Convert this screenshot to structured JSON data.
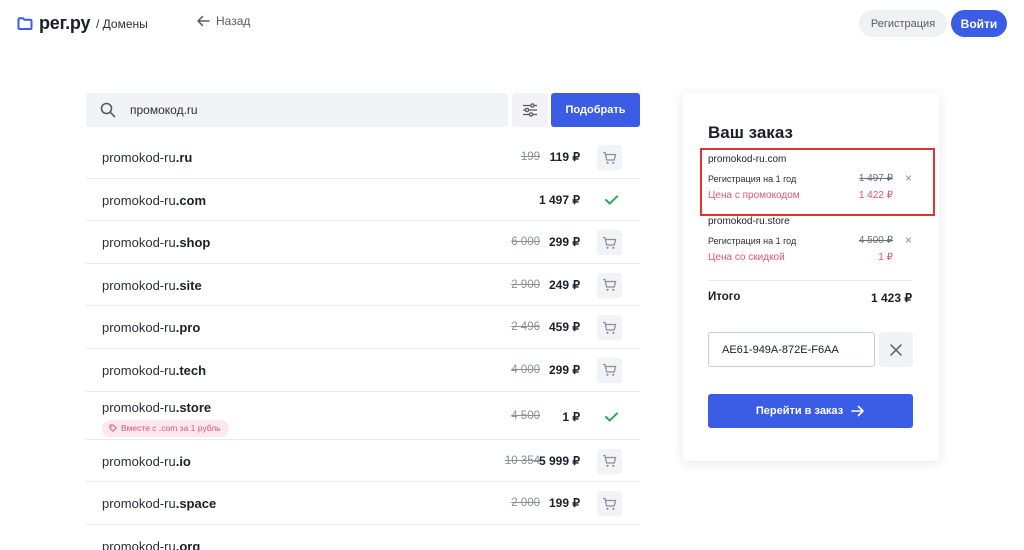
{
  "header": {
    "logo_text": "рег.ру",
    "breadcrumb": "/ Домены",
    "back_label": "Назад",
    "register_label": "Регистрация",
    "login_label": "Войти"
  },
  "search": {
    "query": "промокод.ru",
    "submit_label": "Подобрать"
  },
  "domains": [
    {
      "name": "promokod-ru",
      "tld": ".ru",
      "old_price": "199",
      "price": "119 ₽",
      "state": "cart"
    },
    {
      "name": "promokod-ru",
      "tld": ".com",
      "old_price": "",
      "price": "1 497 ₽",
      "state": "added"
    },
    {
      "name": "promokod-ru",
      "tld": ".shop",
      "old_price": "6 000",
      "price": "299 ₽",
      "state": "cart"
    },
    {
      "name": "promokod-ru",
      "tld": ".site",
      "old_price": "2 900",
      "price": "249 ₽",
      "state": "cart"
    },
    {
      "name": "promokod-ru",
      "tld": ".pro",
      "old_price": "2 496",
      "price": "459 ₽",
      "state": "cart"
    },
    {
      "name": "promokod-ru",
      "tld": ".tech",
      "old_price": "4 000",
      "price": "299 ₽",
      "state": "cart"
    },
    {
      "name": "promokod-ru",
      "tld": ".store",
      "old_price": "4 500",
      "price": "1 ₽",
      "state": "added",
      "badge": "Вместе с .com за 1 рубль"
    },
    {
      "name": "promokod-ru",
      "tld": ".io",
      "old_price": "10 354",
      "price": "5 999 ₽",
      "state": "cart"
    },
    {
      "name": "promokod-ru",
      "tld": ".space",
      "old_price": "2 000",
      "price": "199 ₽",
      "state": "cart"
    },
    {
      "name": "promokod-ru",
      "tld": ".org",
      "old_price": "",
      "price": "",
      "state": "cart"
    }
  ],
  "order": {
    "title": "Ваш заказ",
    "items": [
      {
        "domain": "promokod-ru.com",
        "reg_label": "Регистрация на 1 год",
        "old_price": "1 497 ₽",
        "discount_label": "Цена с промокодом",
        "discount_price": "1 422 ₽"
      },
      {
        "domain": "promokod-ru.store",
        "reg_label": "Регистрация на 1 год",
        "old_price": "4 500 ₽",
        "discount_label": "Цена со скидкой",
        "discount_price": "1 ₽"
      }
    ],
    "remove_symbol": "×",
    "total_label": "Итого",
    "total_value": "1 423 ₽",
    "promo_code": "AE61-949A-872E-F6AA",
    "checkout_label": "Перейти в заказ"
  },
  "colors": {
    "accent": "#3b5ce4",
    "promo": "#e05577",
    "highlight_border": "#e0342c",
    "check": "#2eaa57"
  }
}
